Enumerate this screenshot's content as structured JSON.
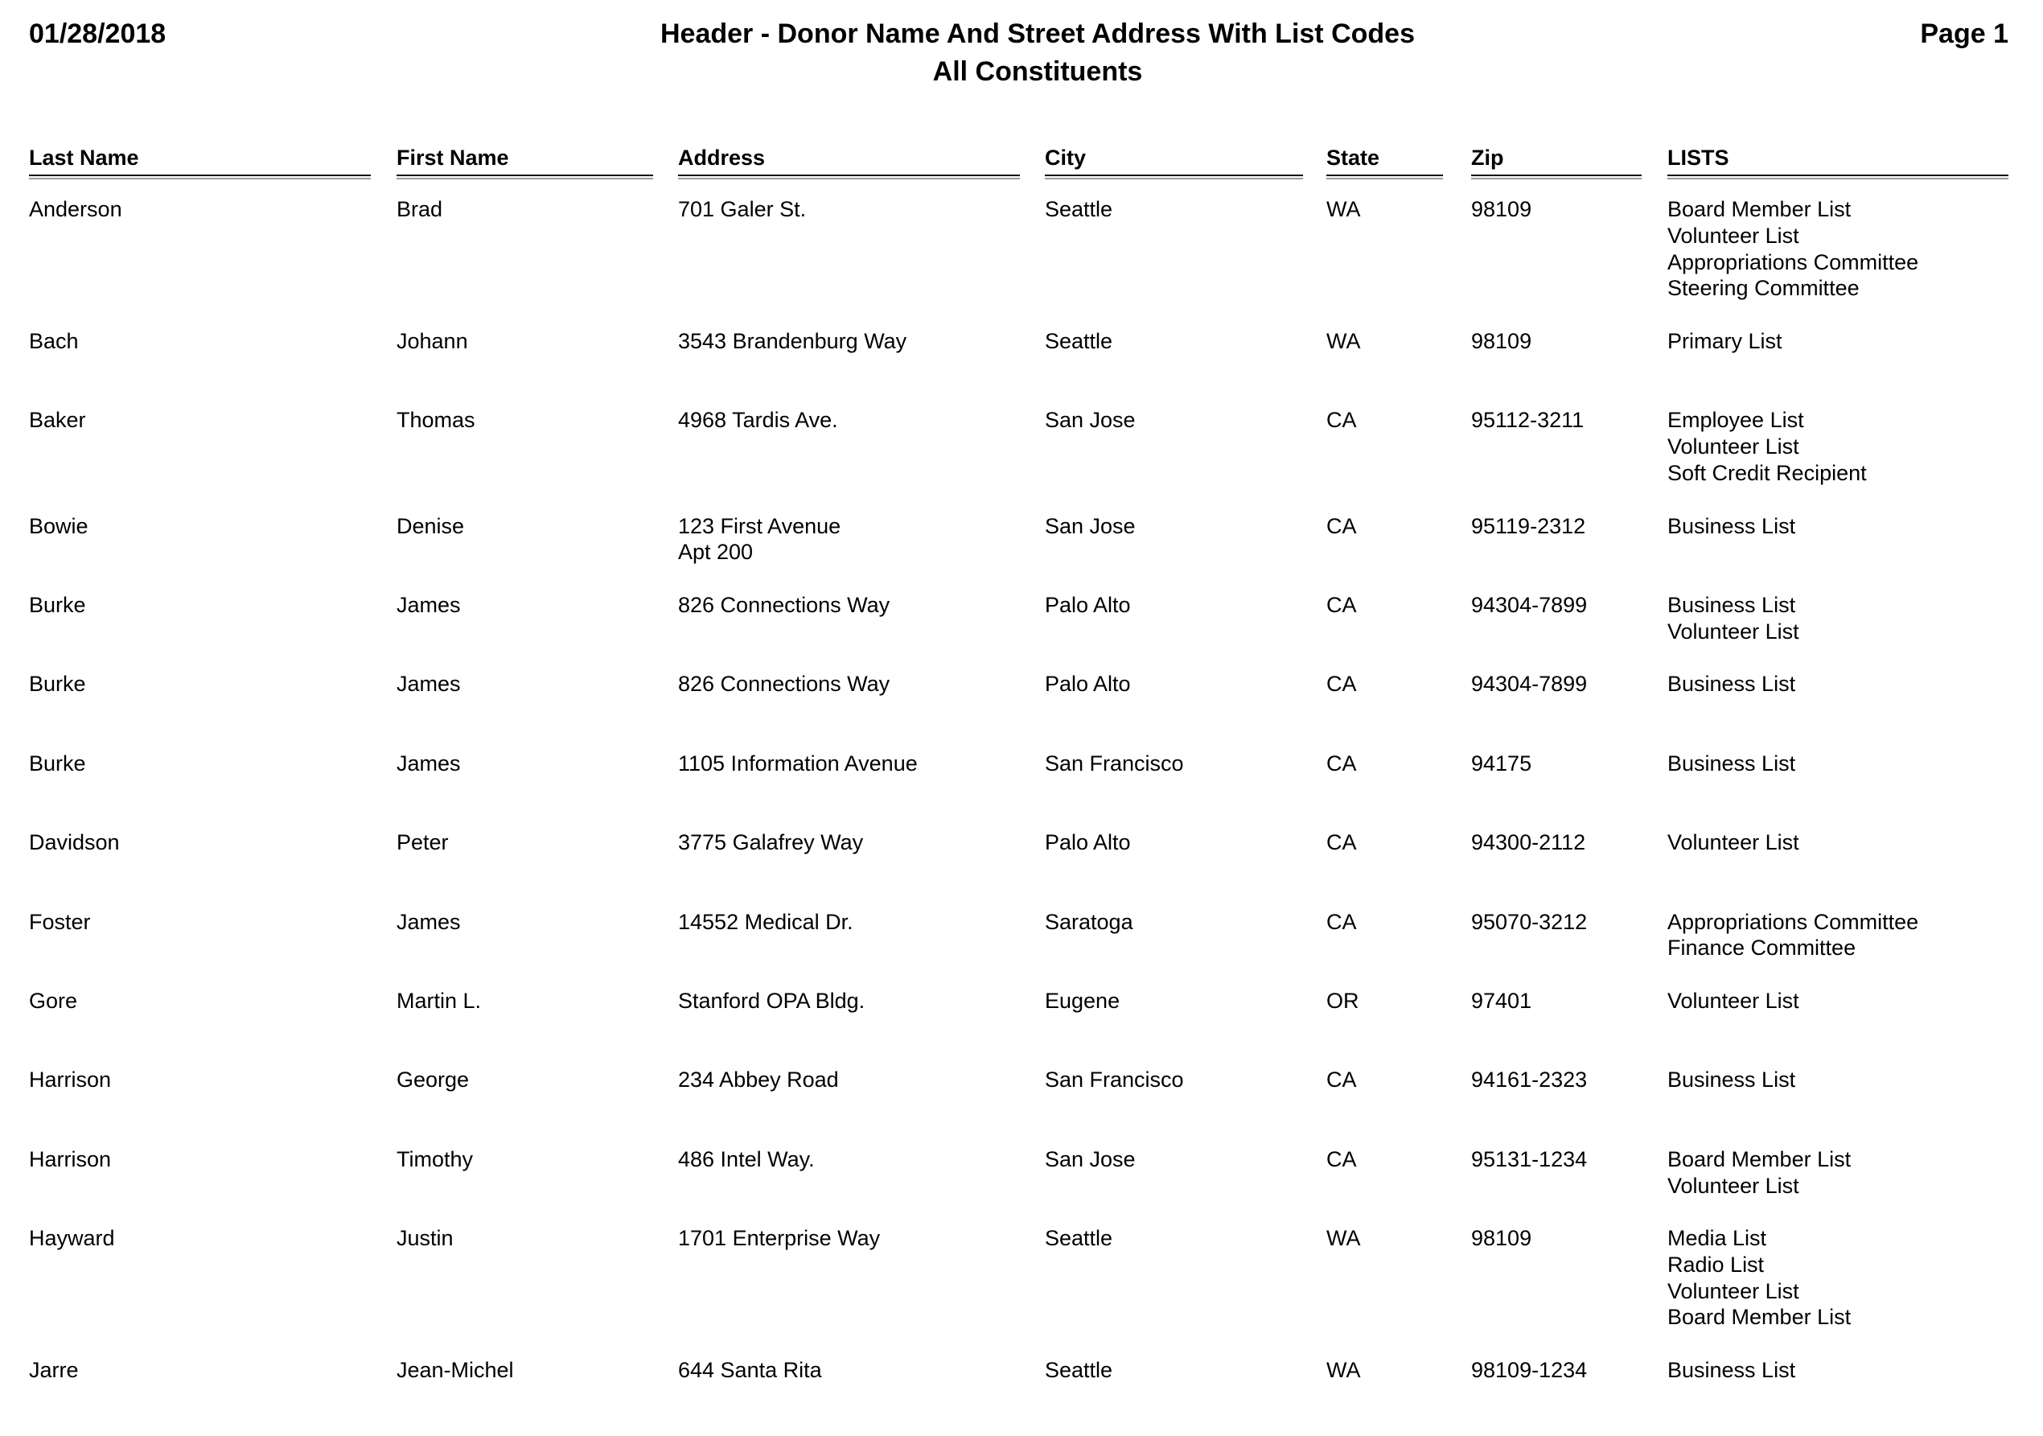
{
  "header": {
    "date": "01/28/2018",
    "title": "Header - Donor Name And Street Address With List Codes",
    "subtitle": "All Constituents",
    "page": "Page 1"
  },
  "columns": [
    {
      "key": "last_name",
      "label": "Last Name"
    },
    {
      "key": "first_name",
      "label": "First Name"
    },
    {
      "key": "address",
      "label": "Address"
    },
    {
      "key": "city",
      "label": "City"
    },
    {
      "key": "state",
      "label": "State"
    },
    {
      "key": "zip",
      "label": "Zip"
    },
    {
      "key": "lists",
      "label": "LISTS"
    }
  ],
  "rows": [
    {
      "last_name": "Anderson",
      "first_name": "Brad",
      "address": [
        "701 Galer St."
      ],
      "city": "Seattle",
      "state": "WA",
      "zip": "98109",
      "lists": [
        "Board Member List",
        "Volunteer List",
        "Appropriations Committee",
        "Steering Committee"
      ]
    },
    {
      "last_name": "Bach",
      "first_name": "Johann",
      "address": [
        "3543 Brandenburg Way"
      ],
      "city": "Seattle",
      "state": "WA",
      "zip": "98109",
      "lists": [
        "Primary List"
      ]
    },
    {
      "last_name": "Baker",
      "first_name": "Thomas",
      "address": [
        "4968 Tardis Ave."
      ],
      "city": "San Jose",
      "state": "CA",
      "zip": "95112-3211",
      "lists": [
        "Employee List",
        "Volunteer List",
        "Soft Credit Recipient"
      ]
    },
    {
      "last_name": "Bowie",
      "first_name": "Denise",
      "address": [
        "123 First Avenue",
        "Apt 200"
      ],
      "city": "San Jose",
      "state": "CA",
      "zip": "95119-2312",
      "lists": [
        "Business List"
      ]
    },
    {
      "last_name": "Burke",
      "first_name": "James",
      "address": [
        "826 Connections Way"
      ],
      "city": "Palo Alto",
      "state": "CA",
      "zip": "94304-7899",
      "lists": [
        "Business List",
        "Volunteer List"
      ]
    },
    {
      "last_name": "Burke",
      "first_name": "James",
      "address": [
        "826 Connections Way"
      ],
      "city": "Palo Alto",
      "state": "CA",
      "zip": "94304-7899",
      "lists": [
        "Business List"
      ]
    },
    {
      "last_name": "Burke",
      "first_name": "James",
      "address": [
        "1105 Information Avenue"
      ],
      "city": "San Francisco",
      "state": "CA",
      "zip": "94175",
      "lists": [
        "Business List"
      ]
    },
    {
      "last_name": "Davidson",
      "first_name": "Peter",
      "address": [
        "3775 Galafrey Way"
      ],
      "city": "Palo Alto",
      "state": "CA",
      "zip": "94300-2112",
      "lists": [
        "Volunteer List"
      ]
    },
    {
      "last_name": "Foster",
      "first_name": "James",
      "address": [
        "14552 Medical Dr."
      ],
      "city": "Saratoga",
      "state": "CA",
      "zip": "95070-3212",
      "lists": [
        "Appropriations Committee",
        "Finance Committee"
      ]
    },
    {
      "last_name": "Gore",
      "first_name": "Martin L.",
      "address": [
        "Stanford OPA Bldg."
      ],
      "city": "Eugene",
      "state": "OR",
      "zip": "97401",
      "lists": [
        "Volunteer List"
      ]
    },
    {
      "last_name": "Harrison",
      "first_name": "George",
      "address": [
        "234 Abbey Road"
      ],
      "city": "San Francisco",
      "state": "CA",
      "zip": "94161-2323",
      "lists": [
        "Business List"
      ]
    },
    {
      "last_name": "Harrison",
      "first_name": "Timothy",
      "address": [
        "486 Intel Way."
      ],
      "city": "San Jose",
      "state": "CA",
      "zip": "95131-1234",
      "lists": [
        "Board Member List",
        "Volunteer List"
      ]
    },
    {
      "last_name": "Hayward",
      "first_name": "Justin",
      "address": [
        "1701 Enterprise Way"
      ],
      "city": "Seattle",
      "state": "WA",
      "zip": "98109",
      "lists": [
        "Media List",
        "Radio List",
        "Volunteer List",
        "Board Member List"
      ]
    },
    {
      "last_name": "Jarre",
      "first_name": "Jean-Michel",
      "address": [
        "644 Santa Rita"
      ],
      "city": "Seattle",
      "state": "WA",
      "zip": "98109-1234",
      "lists": [
        "Business List"
      ]
    }
  ]
}
